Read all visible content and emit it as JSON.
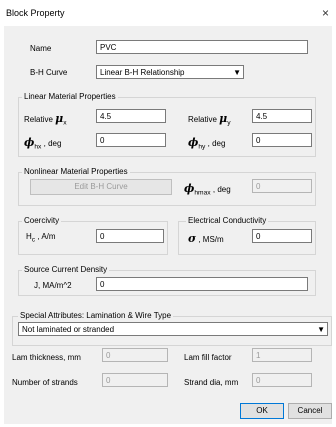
{
  "window": {
    "title": "Block Property",
    "close_glyph": "×"
  },
  "name": {
    "label": "Name",
    "value": "PVC"
  },
  "bh_curve": {
    "label": "B-H Curve",
    "value": "Linear B-H Relationship"
  },
  "linear": {
    "title": "Linear Material Properties",
    "relative_label": "Relative",
    "mu_symbol": "μ",
    "mux_sub": "x",
    "muy_sub": "y",
    "mux_value": "4.5",
    "muy_value": "4.5",
    "phi_symbol": "ϕ",
    "phihx_sub": "hx",
    "phihy_sub": "hy",
    "deg_suffix": ", deg",
    "phihx_value": "0",
    "phihy_value": "0"
  },
  "nonlinear": {
    "title": "Nonlinear Material Properties",
    "edit_button": "Edit B-H Curve",
    "phi_symbol": "ϕ",
    "phihmax_sub": "hmax",
    "deg_suffix": ", deg",
    "phihmax_value": "0"
  },
  "coercivity": {
    "title": "Coercivity",
    "h": "H",
    "sub": "c",
    "unit": ", A/m",
    "value": "0"
  },
  "conductivity": {
    "title": "Electrical Conductivity",
    "sigma": "σ",
    "unit": ", MS/m",
    "value": "0"
  },
  "source": {
    "title": "Source Current Density",
    "label": "J, MA/m^2",
    "value": "0"
  },
  "special": {
    "title": "Special Attributes:  Lamination & Wire Type",
    "type_value": "Not laminated or stranded",
    "lam_thickness_label": "Lam thickness, mm",
    "lam_thickness_value": "0",
    "lam_fill_label": "Lam fill factor",
    "lam_fill_value": "1",
    "strands_label": "Number of strands",
    "strands_value": "0",
    "strand_dia_label": "Strand dia, mm",
    "strand_dia_value": "0"
  },
  "buttons": {
    "ok": "OK",
    "cancel": "Cancel"
  }
}
